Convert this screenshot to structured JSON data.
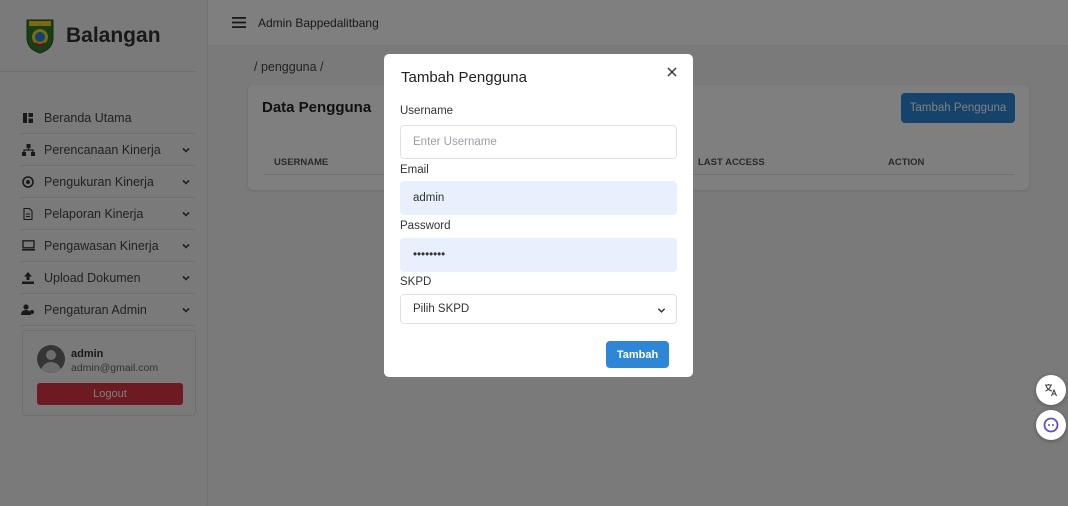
{
  "sidebar": {
    "brand": "Balangan",
    "items": [
      {
        "label": "Beranda Utama",
        "icon": "dashboard-icon",
        "has_submenu": false
      },
      {
        "label": "Perencanaan Kinerja",
        "icon": "sitemap-icon",
        "has_submenu": true
      },
      {
        "label": "Pengukuran Kinerja",
        "icon": "gauge-icon",
        "has_submenu": true
      },
      {
        "label": "Pelaporan Kinerja",
        "icon": "document-icon",
        "has_submenu": true
      },
      {
        "label": "Pengawasan Kinerja",
        "icon": "monitor-icon",
        "has_submenu": true
      },
      {
        "label": "Upload Dokumen",
        "icon": "upload-icon",
        "has_submenu": true
      },
      {
        "label": "Pengaturan Admin",
        "icon": "users-cog-icon",
        "has_submenu": true
      }
    ],
    "user": {
      "name": "admin",
      "email": "admin@gmail.com",
      "logout_label": "Logout"
    }
  },
  "topbar": {
    "title": "Admin Bappedalitbang"
  },
  "main": {
    "breadcrumb": "/ pengguna /",
    "card_title": "Data Pengguna",
    "add_button_label": "Tambah Pengguna",
    "columns": [
      "USERNAME",
      "LAST ACCESS",
      "ACTION"
    ]
  },
  "modal": {
    "title": "Tambah Pengguna",
    "username_label": "Username",
    "username_placeholder": "Enter Username",
    "username_value": "",
    "email_label": "Email",
    "email_value": "admin",
    "password_label": "Password",
    "password_value": "••••••••",
    "skpd_label": "SKPD",
    "skpd_selected": "Pilih SKPD",
    "submit_label": "Tambah"
  },
  "colors": {
    "primary": "#2d86d6",
    "danger": "#dc3545",
    "autofill": "#e8f0fe"
  }
}
